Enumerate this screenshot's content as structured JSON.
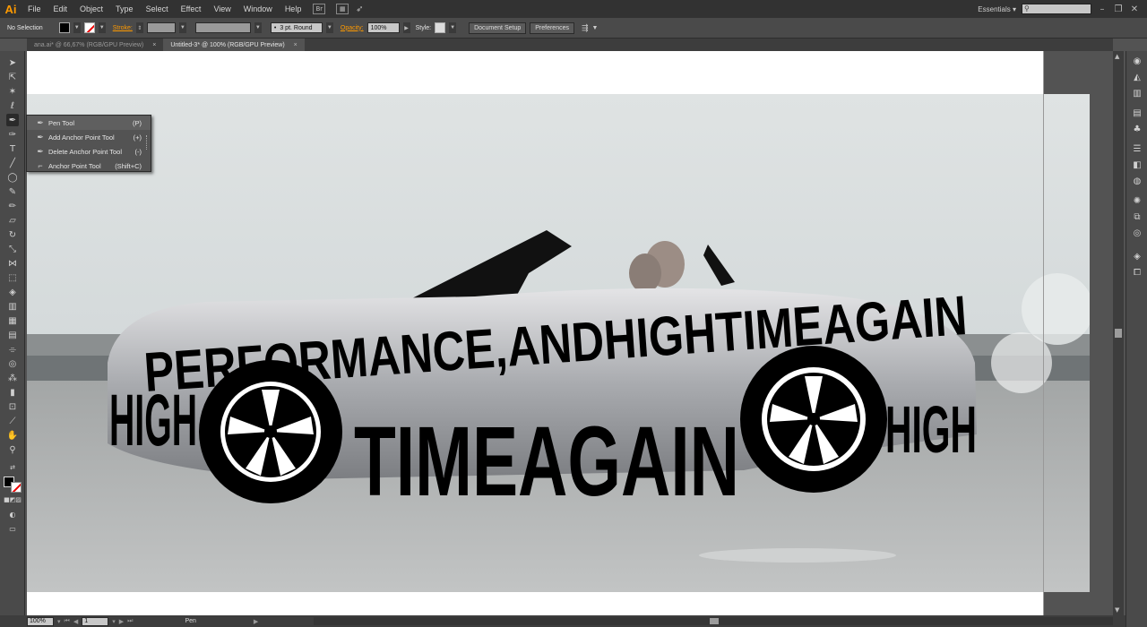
{
  "app": {
    "logo": "Ai"
  },
  "menu": [
    "File",
    "Edit",
    "Object",
    "Type",
    "Select",
    "Effect",
    "View",
    "Window",
    "Help"
  ],
  "menubar_icons": {
    "bridge": "Br"
  },
  "workspace": "Essentials",
  "controlbar": {
    "selection": "No Selection",
    "stroke_label": "Stroke:",
    "brush": "3 pt. Round",
    "opacity_label": "Opacity:",
    "opacity_value": "100%",
    "style_label": "Style:",
    "document_setup": "Document Setup",
    "preferences": "Preferences"
  },
  "tabs": [
    {
      "label": "ana.ai* @ 66,67% (RGB/GPU Preview)",
      "active": false
    },
    {
      "label": "Untitled-3* @ 100% (RGB/GPU Preview)",
      "active": true
    }
  ],
  "tab_close": "×",
  "pen_flyout": [
    {
      "icon": "pen-icon",
      "label": "Pen Tool",
      "shortcut": "(P)"
    },
    {
      "icon": "add-anchor-icon",
      "label": "Add Anchor Point Tool",
      "shortcut": "(+)"
    },
    {
      "icon": "delete-anchor-icon",
      "label": "Delete Anchor Point Tool",
      "shortcut": "(-)"
    },
    {
      "icon": "anchor-point-icon",
      "label": "Anchor Point Tool",
      "shortcut": "(Shift+C)"
    }
  ],
  "artwork": {
    "line1": "PERFORMANCE,ANDHIGHTIMEAGAIN",
    "left": "HIGH",
    "middle": "TIMEAGAIN",
    "right": "HIGH"
  },
  "status": {
    "zoom": "100%",
    "page": "1",
    "tool": "Pen"
  }
}
